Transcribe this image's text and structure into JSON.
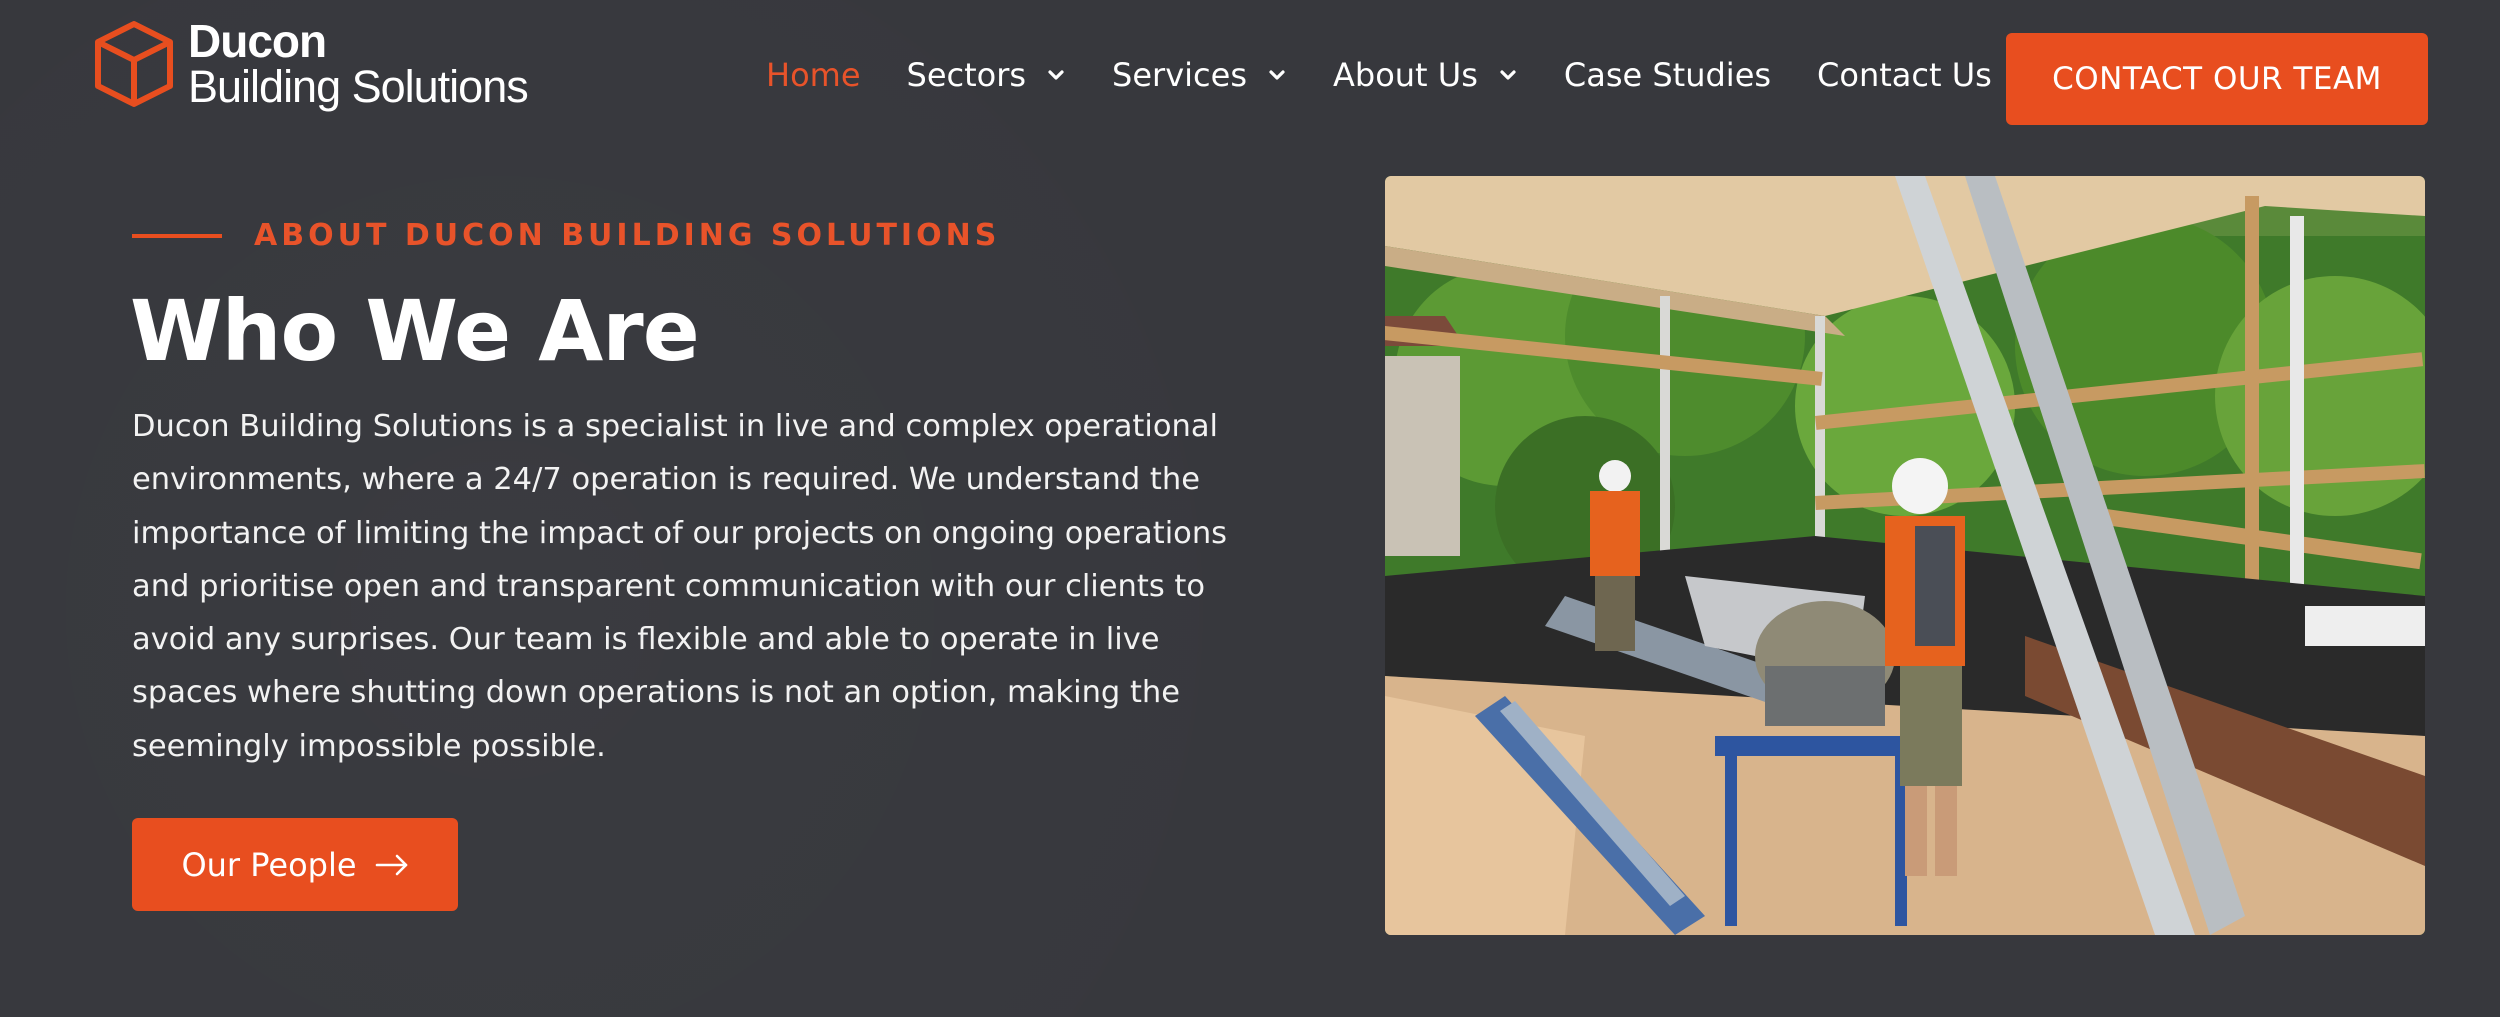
{
  "brand": {
    "name": "Ducon",
    "tagline": "Building Solutions",
    "accent_color": "#e84e1f",
    "background_color": "#37383d",
    "logo_icon": "cube-outline-icon"
  },
  "nav": {
    "items": [
      {
        "label": "Home",
        "active": true,
        "dropdown": false
      },
      {
        "label": "Sectors",
        "active": false,
        "dropdown": true
      },
      {
        "label": "Services",
        "active": false,
        "dropdown": true
      },
      {
        "label": "About Us",
        "active": false,
        "dropdown": true
      },
      {
        "label": "Case Studies",
        "active": false,
        "dropdown": false
      },
      {
        "label": "Contact Us",
        "active": false,
        "dropdown": false
      }
    ],
    "cta_label": "CONTACT OUR TEAM"
  },
  "about": {
    "eyebrow": "ABOUT DUCON BUILDING SOLUTIONS",
    "title": "Who We Are",
    "body": "Ducon Building Solutions is a specialist in live and complex operational environments, where a 24/7 operation is required. We understand the importance of limiting the impact of our projects on ongoing operations and prioritise open and transparent communication with our clients to avoid any surprises. Our team is flexible and able to operate in live spaces where shutting down operations is not an option, making the seemingly impossible possible.",
    "button_label": "Our People",
    "button_icon": "arrow-right-icon"
  },
  "photo": {
    "subject": "two workers using a mitre saw in an open-sided timber-framed building"
  }
}
